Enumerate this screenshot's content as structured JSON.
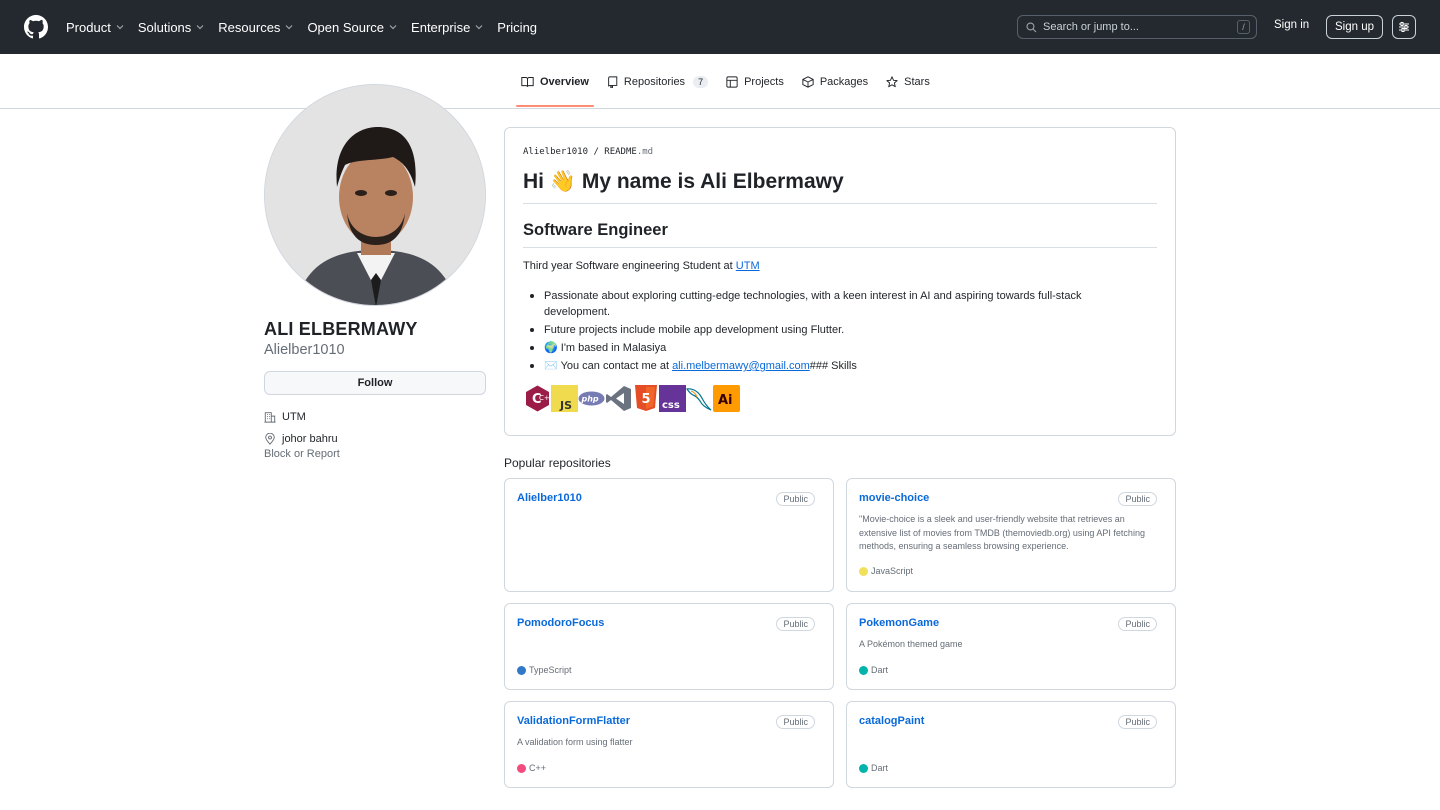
{
  "header": {
    "nav": [
      {
        "label": "Product",
        "dropdown": true
      },
      {
        "label": "Solutions",
        "dropdown": true
      },
      {
        "label": "Resources",
        "dropdown": true
      },
      {
        "label": "Open Source",
        "dropdown": true
      },
      {
        "label": "Enterprise",
        "dropdown": true
      },
      {
        "label": "Pricing",
        "dropdown": false
      }
    ],
    "search_placeholder": "Search or jump to...",
    "search_shortcut": "/",
    "sign_in": "Sign in",
    "sign_up": "Sign up"
  },
  "tabs": [
    {
      "label": "Overview",
      "icon": "book-icon",
      "active": true
    },
    {
      "label": "Repositories",
      "icon": "repo-icon",
      "count": "7"
    },
    {
      "label": "Projects",
      "icon": "table-icon"
    },
    {
      "label": "Packages",
      "icon": "package-icon"
    },
    {
      "label": "Stars",
      "icon": "star-icon"
    }
  ],
  "profile": {
    "full_name": "ALI ELBERMAWY",
    "username": "Alielber1010",
    "follow": "Follow",
    "organization": "UTM",
    "location": "johor bahru",
    "block_report": "Block or Report"
  },
  "readme": {
    "owner": "Alielber1010",
    "separator": "/",
    "file": "README",
    "ext": ".md",
    "h1_pre": "Hi ",
    "h1_emoji": "👋",
    "h1_post": " My name is Ali Elbermawy",
    "h2": "Software Engineer",
    "intro_text": "Third year Software engineering Student at ",
    "intro_link": "UTM",
    "bullets": {
      "b1": "Passionate about exploring cutting-edge technologies, with a keen interest in AI and aspiring towards full-stack development.",
      "b2": "Future projects include mobile app development using Flutter.",
      "b3_emoji": "🌍",
      "b3": "I'm based in Malasiya",
      "b4_emoji": "✉️",
      "b4_pre": "You can contact me at ",
      "b4_link": "ali.melbermawy@gmail.com",
      "b4_post": "### Skills"
    },
    "skills": [
      {
        "icon": "cplusplus-icon",
        "label": "C+",
        "bg": "#9b1c46"
      },
      {
        "icon": "javascript-icon",
        "label": "JS",
        "bg": "#f0db4f"
      },
      {
        "icon": "php-icon",
        "label": "php",
        "bg": "#777bb3"
      },
      {
        "icon": "visual-studio-icon",
        "label": "",
        "bg": "#6b7280"
      },
      {
        "icon": "html5-icon",
        "label": "5",
        "bg": "#e44d26"
      },
      {
        "icon": "css3-icon",
        "label": "css",
        "bg": "#663399"
      },
      {
        "icon": "mysql-icon",
        "label": "",
        "bg": "#00758f"
      },
      {
        "icon": "illustrator-icon",
        "label": "Ai",
        "bg": "#ff9a00"
      }
    ]
  },
  "popular": {
    "title": "Popular repositories",
    "repos": [
      {
        "name": "Alielber1010",
        "visibility": "Public",
        "description": "",
        "language": "",
        "color": ""
      },
      {
        "name": "movie-choice",
        "visibility": "Public",
        "description": "\"Movie-choice is a sleek and user-friendly website that retrieves an extensive list of movies from TMDB (themoviedb.org) using API fetching methods, ensuring a seamless browsing experience.",
        "language": "JavaScript",
        "color": "#f1e05a"
      },
      {
        "name": "PomodoroFocus",
        "visibility": "Public",
        "description": "",
        "language": "TypeScript",
        "color": "#3178c6"
      },
      {
        "name": "PokemonGame",
        "visibility": "Public",
        "description": "A Pokémon themed game",
        "language": "Dart",
        "color": "#00b4ab"
      },
      {
        "name": "ValidationFormFlatter",
        "visibility": "Public",
        "description": "A validation form using flatter",
        "language": "C++",
        "color": "#f34b7d"
      },
      {
        "name": "catalogPaint",
        "visibility": "Public",
        "description": "",
        "language": "Dart",
        "color": "#00b4ab"
      }
    ]
  }
}
